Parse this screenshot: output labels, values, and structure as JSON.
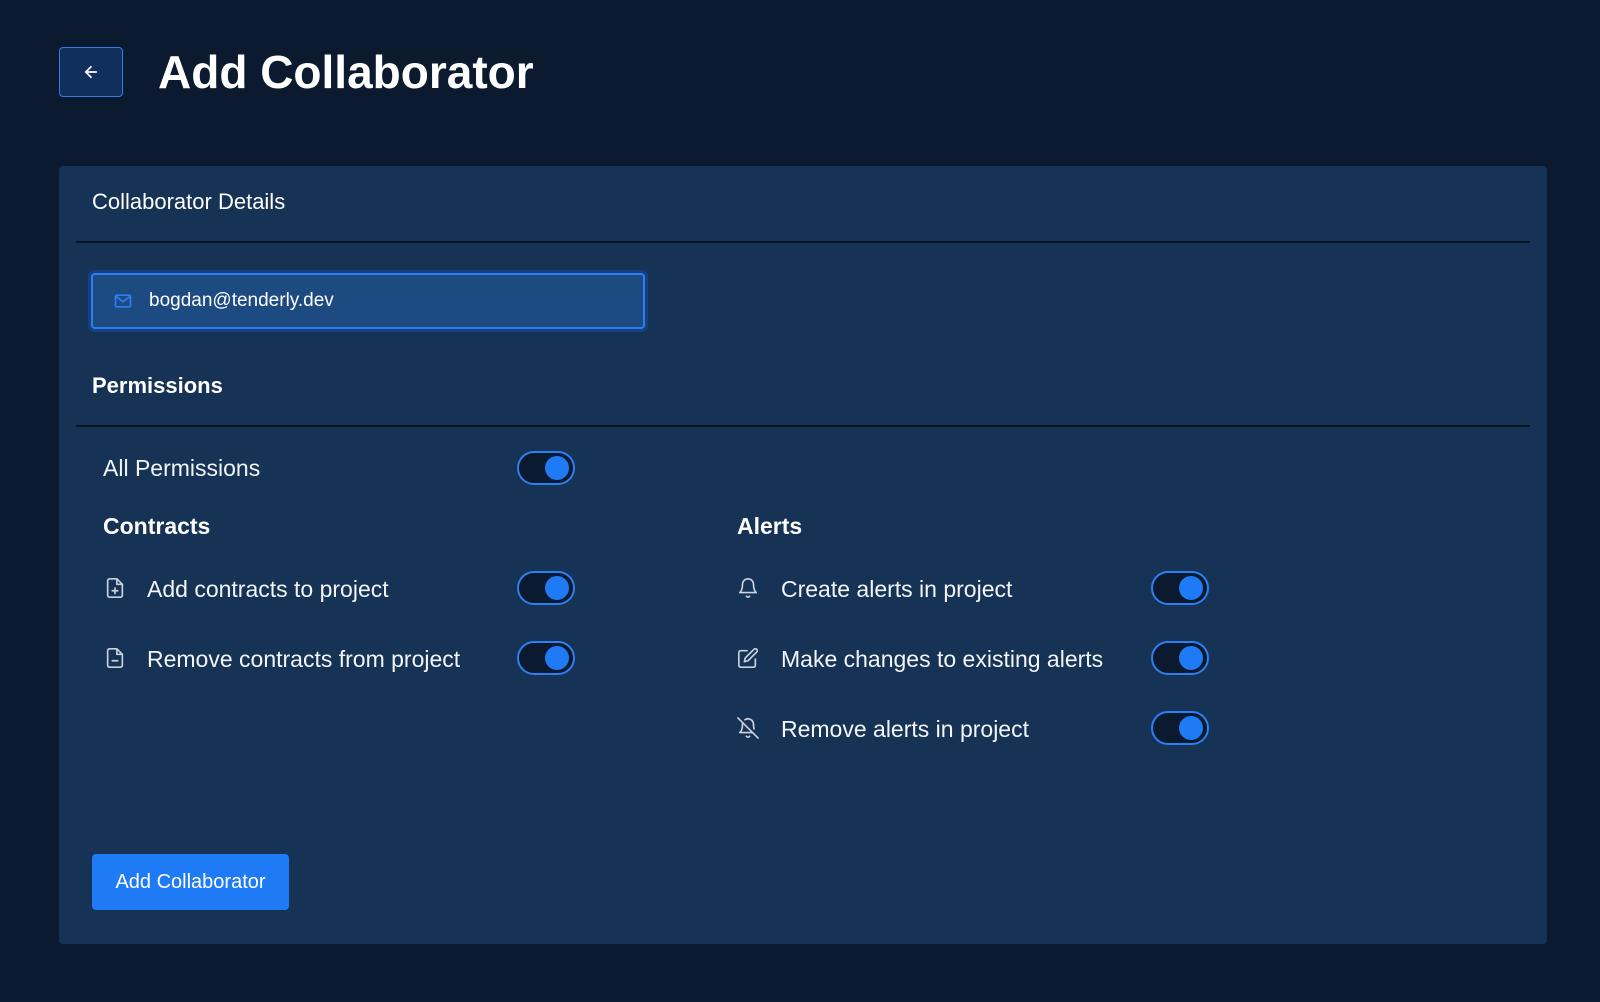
{
  "header": {
    "back_label": "Back",
    "title": "Add Collaborator"
  },
  "details": {
    "title": "Collaborator Details",
    "email_value": "bogdan@tenderly.dev",
    "email_placeholder": "Email"
  },
  "permissions": {
    "title": "Permissions",
    "all": {
      "label": "All Permissions",
      "enabled": true
    },
    "contracts": {
      "title": "Contracts",
      "items": [
        {
          "label": "Add contracts to project",
          "icon": "file-plus-icon",
          "enabled": true
        },
        {
          "label": "Remove contracts from project",
          "icon": "file-minus-icon",
          "enabled": true
        }
      ]
    },
    "alerts": {
      "title": "Alerts",
      "items": [
        {
          "label": "Create alerts in project",
          "icon": "bell-icon",
          "enabled": true
        },
        {
          "label": "Make changes to existing alerts",
          "icon": "edit-icon",
          "enabled": true
        },
        {
          "label": "Remove alerts in project",
          "icon": "bell-off-icon",
          "enabled": true
        }
      ]
    }
  },
  "actions": {
    "submit_label": "Add Collaborator"
  },
  "colors": {
    "background": "#0b1a2e",
    "card": "#163255",
    "accent": "#1f7bf5"
  }
}
